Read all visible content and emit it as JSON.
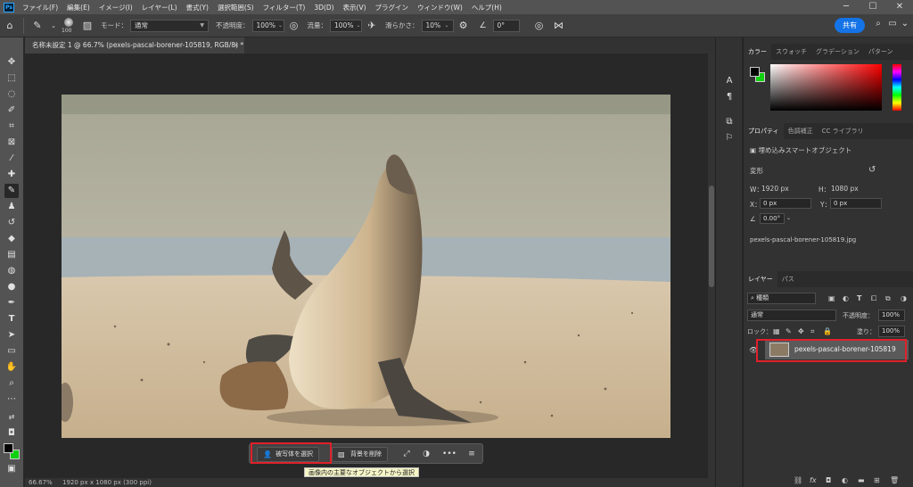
{
  "menu": {
    "items": [
      "ファイル(F)",
      "編集(E)",
      "イメージ(I)",
      "レイヤー(L)",
      "書式(Y)",
      "選択範囲(S)",
      "フィルター(T)",
      "3D(D)",
      "表示(V)",
      "プラグイン",
      "ウィンドウ(W)",
      "ヘルプ(H)"
    ]
  },
  "window": {
    "minimize": "─",
    "maximize": "☐",
    "close": "✕"
  },
  "options": {
    "brush_size": "100",
    "mode_label": "モード：",
    "mode_value": "通常",
    "opacity_label": "不透明度：",
    "opacity_value": "100%",
    "flow_label": "流量：",
    "flow_value": "100%",
    "smoothing_label": "滑らかさ：",
    "smoothing_value": "10%",
    "angle_value": "0°",
    "share_label": "共有"
  },
  "document": {
    "tab_title": "名称未設定 1 @ 66.7% (pexels-pascal-borener-105819, RGB/8) *",
    "zoom": "66.67%",
    "info": "1920 px x 1080 px (300 ppi)"
  },
  "taskbar": {
    "select_subject_label": "被写体を選択",
    "remove_bg_label": "背景を削除",
    "more_label": "•••",
    "tooltip": "画像内の主要なオブジェクトから選択"
  },
  "color_panel": {
    "tabs": [
      "カラー",
      "スウォッチ",
      "グラデーション",
      "パターン"
    ],
    "foreground": "#000000",
    "background": "#10d010"
  },
  "properties_panel": {
    "tabs": [
      "プロパティ",
      "色調補正",
      "CC ライブラリ"
    ],
    "object_type": "埋め込みスマートオブジェクト",
    "transform_label": "変形",
    "w_label": "W：",
    "w_value": "1920 px",
    "h_label": "H：",
    "h_value": "1080 px",
    "x_label": "X：",
    "x_value": "0 px",
    "y_label": "Y：",
    "y_value": "0 px",
    "angle_value": "0.00°",
    "filename": "pexels-pascal-borener-105819.jpg"
  },
  "layers_panel": {
    "tabs": [
      "レイヤー",
      "パス"
    ],
    "filter_kind": "種類",
    "blend_mode": "通常",
    "opacity_label": "不透明度：",
    "opacity_value": "100%",
    "lock_label": "ロック：",
    "fill_label": "塗り：",
    "fill_value": "100%",
    "layer_name": "pexels-pascal-borener-105819"
  },
  "accent_colors": {
    "share_blue": "#1473e6",
    "highlight_red": "#e0202a"
  }
}
